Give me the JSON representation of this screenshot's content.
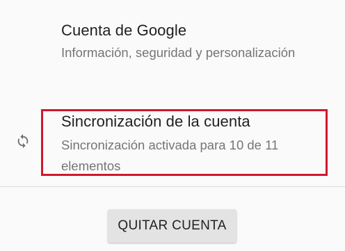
{
  "settings": {
    "google_account": {
      "title": "Cuenta de Google",
      "subtitle": "Información, seguridad y personalización"
    },
    "account_sync": {
      "icon": "sync-icon",
      "title": "Sincronización de la cuenta",
      "subtitle": "Sincronización activada para 10 de 11 elementos"
    }
  },
  "actions": {
    "remove_account_label": "QUITAR CUENTA"
  },
  "colors": {
    "highlight": "#d0182c",
    "title_text": "#212121",
    "subtitle_text": "#757575",
    "button_bg": "#e3e3e3"
  }
}
